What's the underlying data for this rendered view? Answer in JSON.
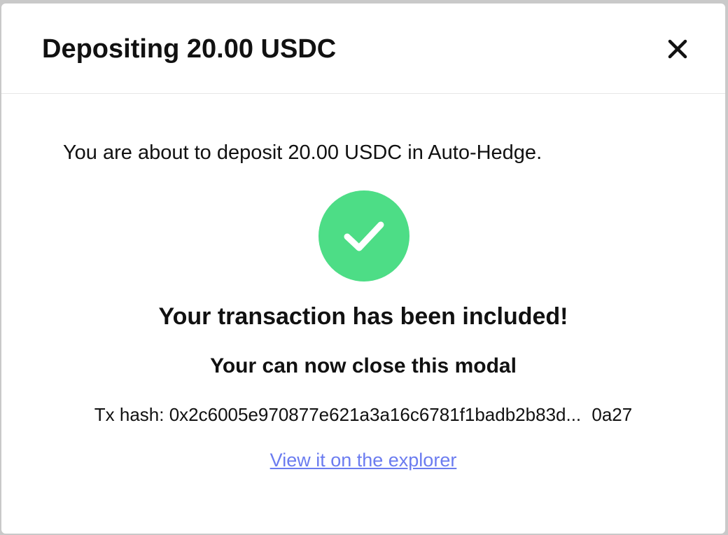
{
  "modal": {
    "title": "Depositing 20.00 USDC",
    "close_icon": "close-icon"
  },
  "body": {
    "intro": "You are about to deposit 20.00 USDC in Auto-Hedge.",
    "status_icon": "checkmark-icon",
    "headline": "Your transaction has been included!",
    "subheadline": "Your can now close this modal",
    "tx_label": "Tx hash:",
    "tx_hash_start": "0x2c6005e970877e621a3a16c6781f1badb2b83d...",
    "tx_hash_end": "0a27",
    "explorer_link": "View it on the explorer"
  },
  "colors": {
    "success": "#4ddd86",
    "link": "#6b7cf0",
    "text": "#111111"
  }
}
